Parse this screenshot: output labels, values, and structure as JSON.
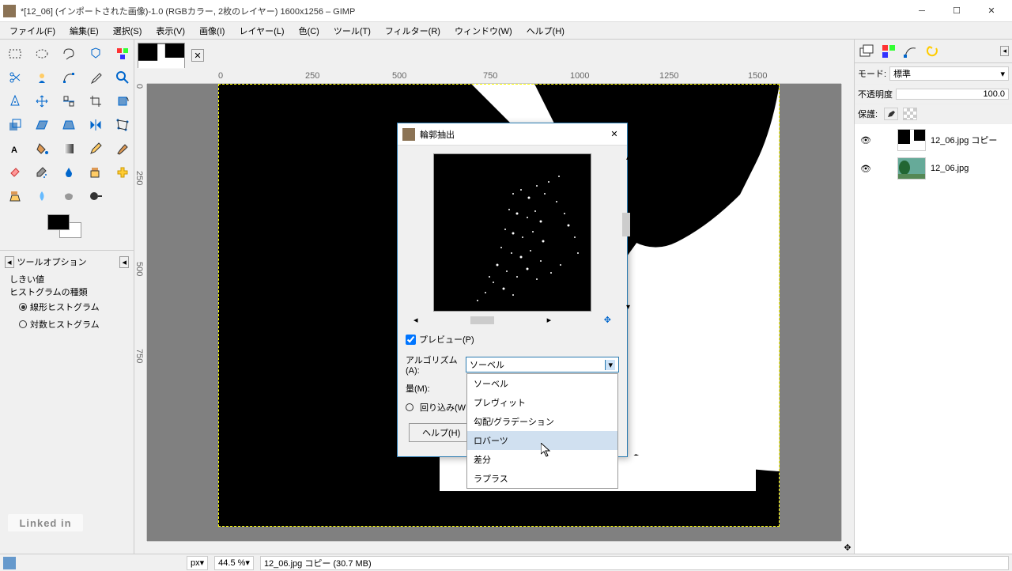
{
  "window": {
    "title": "*[12_06] (インポートされた画像)-1.0 (RGBカラー, 2枚のレイヤー) 1600x1256 – GIMP"
  },
  "menubar": [
    "ファイル(F)",
    "編集(E)",
    "選択(S)",
    "表示(V)",
    "画像(I)",
    "レイヤー(L)",
    "色(C)",
    "ツール(T)",
    "フィルター(R)",
    "ウィンドウ(W)",
    "ヘルプ(H)"
  ],
  "toolbox": {
    "option_title": "ツールオプション",
    "threshold_label": "しきい値",
    "histogram_label": "ヒストグラムの種類",
    "radio1": "線形ヒストグラム",
    "radio2": "対数ヒストグラム"
  },
  "ruler": {
    "h": [
      "0",
      "250",
      "500",
      "750",
      "1000",
      "1250",
      "1500"
    ],
    "v": [
      "0",
      "250",
      "500",
      "750"
    ]
  },
  "statusbar": {
    "unit": "px",
    "zoom": "44.5 %",
    "status": "12_06.jpg コピー (30.7 MB)"
  },
  "right": {
    "mode_label": "モード:",
    "mode_value": "標準",
    "opacity_label": "不透明度",
    "opacity_value": "100.0",
    "lock_label": "保護:",
    "layers": [
      {
        "name": "12_06.jpg コピー"
      },
      {
        "name": "12_06.jpg"
      }
    ]
  },
  "dialog": {
    "title": "輪郭抽出",
    "preview_check": "プレビュー(P)",
    "algorithm_label": "アルゴリズム(A):",
    "algorithm_value": "ソーベル",
    "amount_label": "量(M):",
    "wrap_label": "回り込み(W",
    "help_btn": "ヘルプ(H)",
    "options": [
      "ソーベル",
      "プレヴィット",
      "勾配/グラデーション",
      "ロバーツ",
      "差分",
      "ラプラス"
    ]
  },
  "watermark": "Linked in"
}
